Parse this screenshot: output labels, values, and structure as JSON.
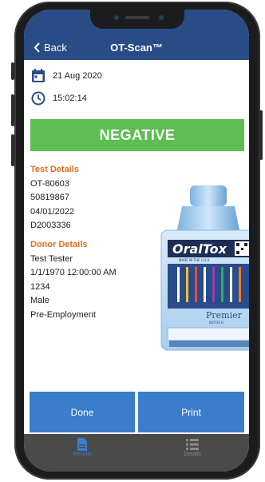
{
  "nav": {
    "back_label": "Back",
    "title": "OT-Scan™"
  },
  "meta": {
    "date": "21 Aug 2020",
    "time": "15:02:14"
  },
  "result": {
    "label": "NEGATIVE",
    "color": "#5dbe52"
  },
  "test_details": {
    "header": "Test Details",
    "lines": [
      "OT-80603",
      "50819867",
      "04/01/2022",
      "D2003336"
    ]
  },
  "donor_details": {
    "header": "Donor Details",
    "lines": [
      "Test Tester",
      "1/1/1970 12:00:00 AM",
      "1234",
      "Male",
      "Pre-Employment"
    ]
  },
  "device": {
    "brand": "OralTox",
    "made_in": "MADE IN THE U.S.A.",
    "maker": "Premier",
    "maker_sub": "BIOTECH"
  },
  "actions": {
    "done_label": "Done",
    "print_label": "Print"
  },
  "tabs": [
    {
      "label": "Results",
      "icon": "document-icon",
      "active": true
    },
    {
      "label": "Details",
      "icon": "list-icon",
      "active": false
    }
  ],
  "colors": {
    "nav": "#2a4c86",
    "accent": "#e0701d",
    "button": "#3a7dcb",
    "tabbar": "#4a4a4a"
  }
}
